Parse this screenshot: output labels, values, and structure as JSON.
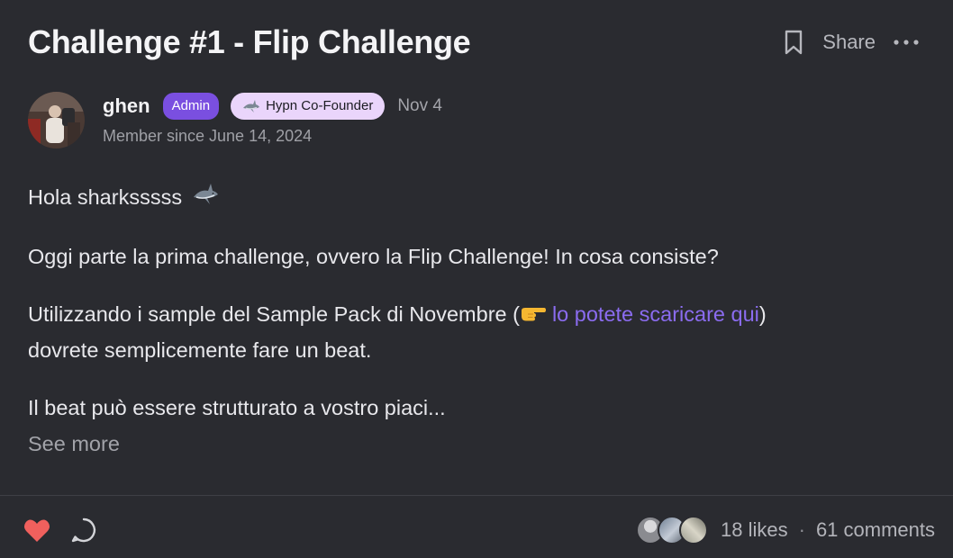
{
  "post": {
    "title": "Challenge #1 - Flip Challenge",
    "share_label": "Share",
    "author": {
      "name": "ghen",
      "admin_badge": "Admin",
      "founder_badge": "Hypn Co-Founder",
      "date": "Nov 4",
      "member_since": "Member since June 14, 2024"
    },
    "body": {
      "greeting": "Hola sharksssss",
      "intro": "Oggi parte la prima challenge, ovvero la Flip Challenge! In cosa consiste?",
      "samples_before": "Utilizzando i sample del Sample Pack di Novembre (",
      "samples_link": "lo potete scaricare qui",
      "samples_after": ")",
      "samples_line2": "dovrete semplicemente fare un beat.",
      "structure": "Il beat può essere strutturato a vostro piaci..."
    },
    "see_more": "See more",
    "footer": {
      "likes": "18 likes",
      "separator": "·",
      "comments": "61 comments"
    }
  },
  "colors": {
    "background": "#2a2b30",
    "accent": "#7a4fe0",
    "link": "#8b6cf0",
    "founder_badge_bg": "#ead5fb",
    "heart": "#f0605d"
  },
  "icons": [
    "bookmark-icon",
    "more-icon",
    "shark-icon",
    "pointing-hand-icon",
    "heart-icon",
    "comment-icon"
  ]
}
